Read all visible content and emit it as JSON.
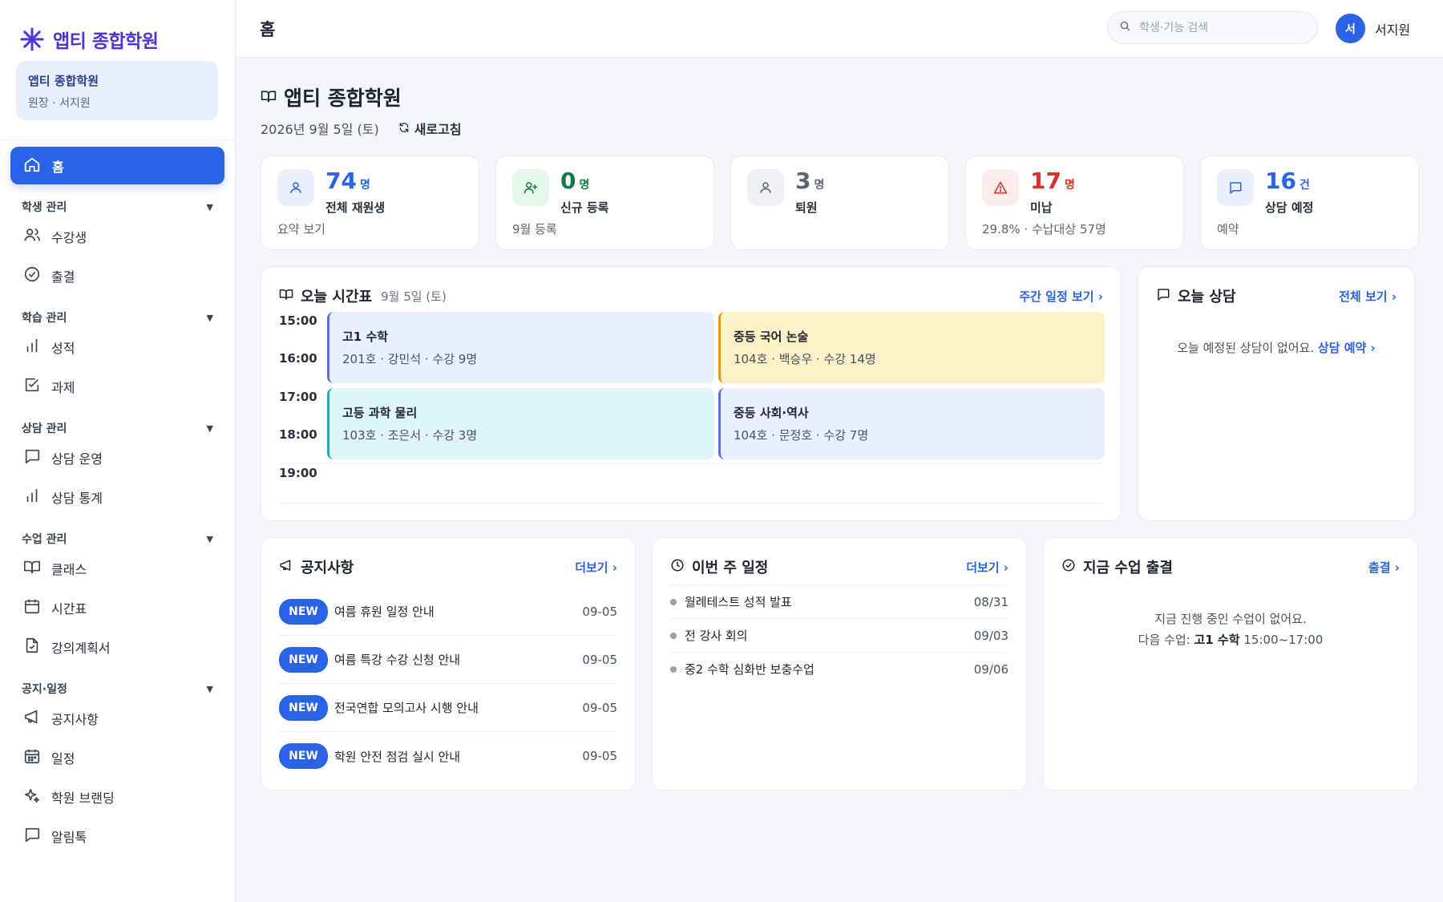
{
  "brand": {
    "name": "앱티 종합학원",
    "accent": "#4b35d6"
  },
  "org": {
    "name": "앱티 종합학원",
    "role": "원장 · 서지원"
  },
  "nav": {
    "home": "홈",
    "groups": [
      {
        "label": "학생 관리",
        "items": [
          {
            "label": "수강생",
            "icon": "users-icon"
          },
          {
            "label": "출결",
            "icon": "check-circle-icon"
          }
        ]
      },
      {
        "label": "학습 관리",
        "items": [
          {
            "label": "성적",
            "icon": "bar-chart-icon"
          },
          {
            "label": "과제",
            "icon": "check-square-icon"
          }
        ]
      },
      {
        "label": "상담 관리",
        "items": [
          {
            "label": "상담 운영",
            "icon": "message-icon"
          },
          {
            "label": "상담 통계",
            "icon": "bar-chart-icon"
          }
        ]
      },
      {
        "label": "수업 관리",
        "items": [
          {
            "label": "클래스",
            "icon": "book-icon"
          },
          {
            "label": "시간표",
            "icon": "calendar-icon"
          },
          {
            "label": "강의계획서",
            "icon": "file-check-icon"
          }
        ]
      },
      {
        "label": "공지·일정",
        "items": [
          {
            "label": "공지사항",
            "icon": "megaphone-icon"
          },
          {
            "label": "일정",
            "icon": "calendar-grid-icon"
          },
          {
            "label": "학원 브랜딩",
            "icon": "sparkle-icon"
          },
          {
            "label": "알림톡",
            "icon": "message-icon"
          }
        ]
      }
    ]
  },
  "topbar": {
    "title": "홈",
    "search_placeholder": "학생·기능 검색",
    "user_initial": "서",
    "user_name": "서지원"
  },
  "page": {
    "title": "앱티 종합학원",
    "date": "2026년 9월 5일 (토)",
    "refresh": "새로고침"
  },
  "stats": [
    {
      "num": "74",
      "unit": "명",
      "label": "전체 재원생",
      "foot": "요약 보기",
      "color": "#2b63e6",
      "bg": "#e9f0fd"
    },
    {
      "num": "0",
      "unit": "명",
      "label": "신규 등록",
      "foot": "9월 등록",
      "color": "#16794a",
      "bg": "#e5f6ec"
    },
    {
      "num": "3",
      "unit": "명",
      "label": "퇴원",
      "foot": "",
      "color": "#5d6473",
      "bg": "#eef0f4"
    },
    {
      "num": "17",
      "unit": "명",
      "label": "미납",
      "foot": "29.8% · 수납대상 57명",
      "color": "#d9302c",
      "bg": "#fdecec"
    },
    {
      "num": "16",
      "unit": "건",
      "label": "상담 예정",
      "foot": "예약",
      "color": "#2b63e6",
      "bg": "#e9f0fd"
    }
  ],
  "timetable": {
    "title": "오늘 시간표",
    "subtitle": "9월 5일 (토)",
    "link": "주간 일정 보기 ›",
    "hours": [
      "15:00",
      "16:00",
      "17:00",
      "18:00",
      "19:00"
    ],
    "lessons": [
      {
        "title": "고1 수학",
        "detail": "201호 · 강민석 · 수강 9명",
        "bg": "#e9effc",
        "border": "#5f6fd8"
      },
      {
        "title": "중등 국어 논술",
        "detail": "104호 · 백승우 · 수강 14명",
        "bg": "#fdf1c8",
        "border": "#e59b16"
      },
      {
        "title": "고등 과학 물리",
        "detail": "103호 · 조은서 · 수강 3명",
        "bg": "#dff6f7",
        "border": "#22a9b3"
      },
      {
        "title": "중등 사회·역사",
        "detail": "104호 · 문정호 · 수강 7명",
        "bg": "#e9effc",
        "border": "#5f6fd8"
      }
    ]
  },
  "consult": {
    "title": "오늘 상담",
    "link": "전체 보기 ›",
    "empty": "오늘 예정된 상담이 없어요.",
    "empty_link": "상담 예약 ›"
  },
  "notices": {
    "title": "공지사항",
    "link": "더보기 ›",
    "items": [
      {
        "badge": "NEW",
        "title": "여름 휴원 일정 안내",
        "date": "09-05"
      },
      {
        "badge": "NEW",
        "title": "여름 특강 수강 신청 안내",
        "date": "09-05"
      },
      {
        "badge": "NEW",
        "title": "전국연합 모의고사 시행 안내",
        "date": "09-05"
      },
      {
        "badge": "NEW",
        "title": "학원 안전 점검 실시 안내",
        "date": "09-05"
      }
    ]
  },
  "week": {
    "title": "이번 주 일정",
    "link": "더보기 ›",
    "items": [
      {
        "title": "월례테스트 성적 발표",
        "date": "08/31"
      },
      {
        "title": "전 강사 회의",
        "date": "09/03"
      },
      {
        "title": "중2 수학 심화반 보충수업",
        "date": "09/06"
      }
    ]
  },
  "attendance": {
    "title": "지금 수업 출결",
    "link": "출결 ›",
    "empty": "지금 진행 중인 수업이 없어요.",
    "next_label": "다음 수업:",
    "next_class": "고1 수학",
    "next_time": "15:00~17:00"
  }
}
